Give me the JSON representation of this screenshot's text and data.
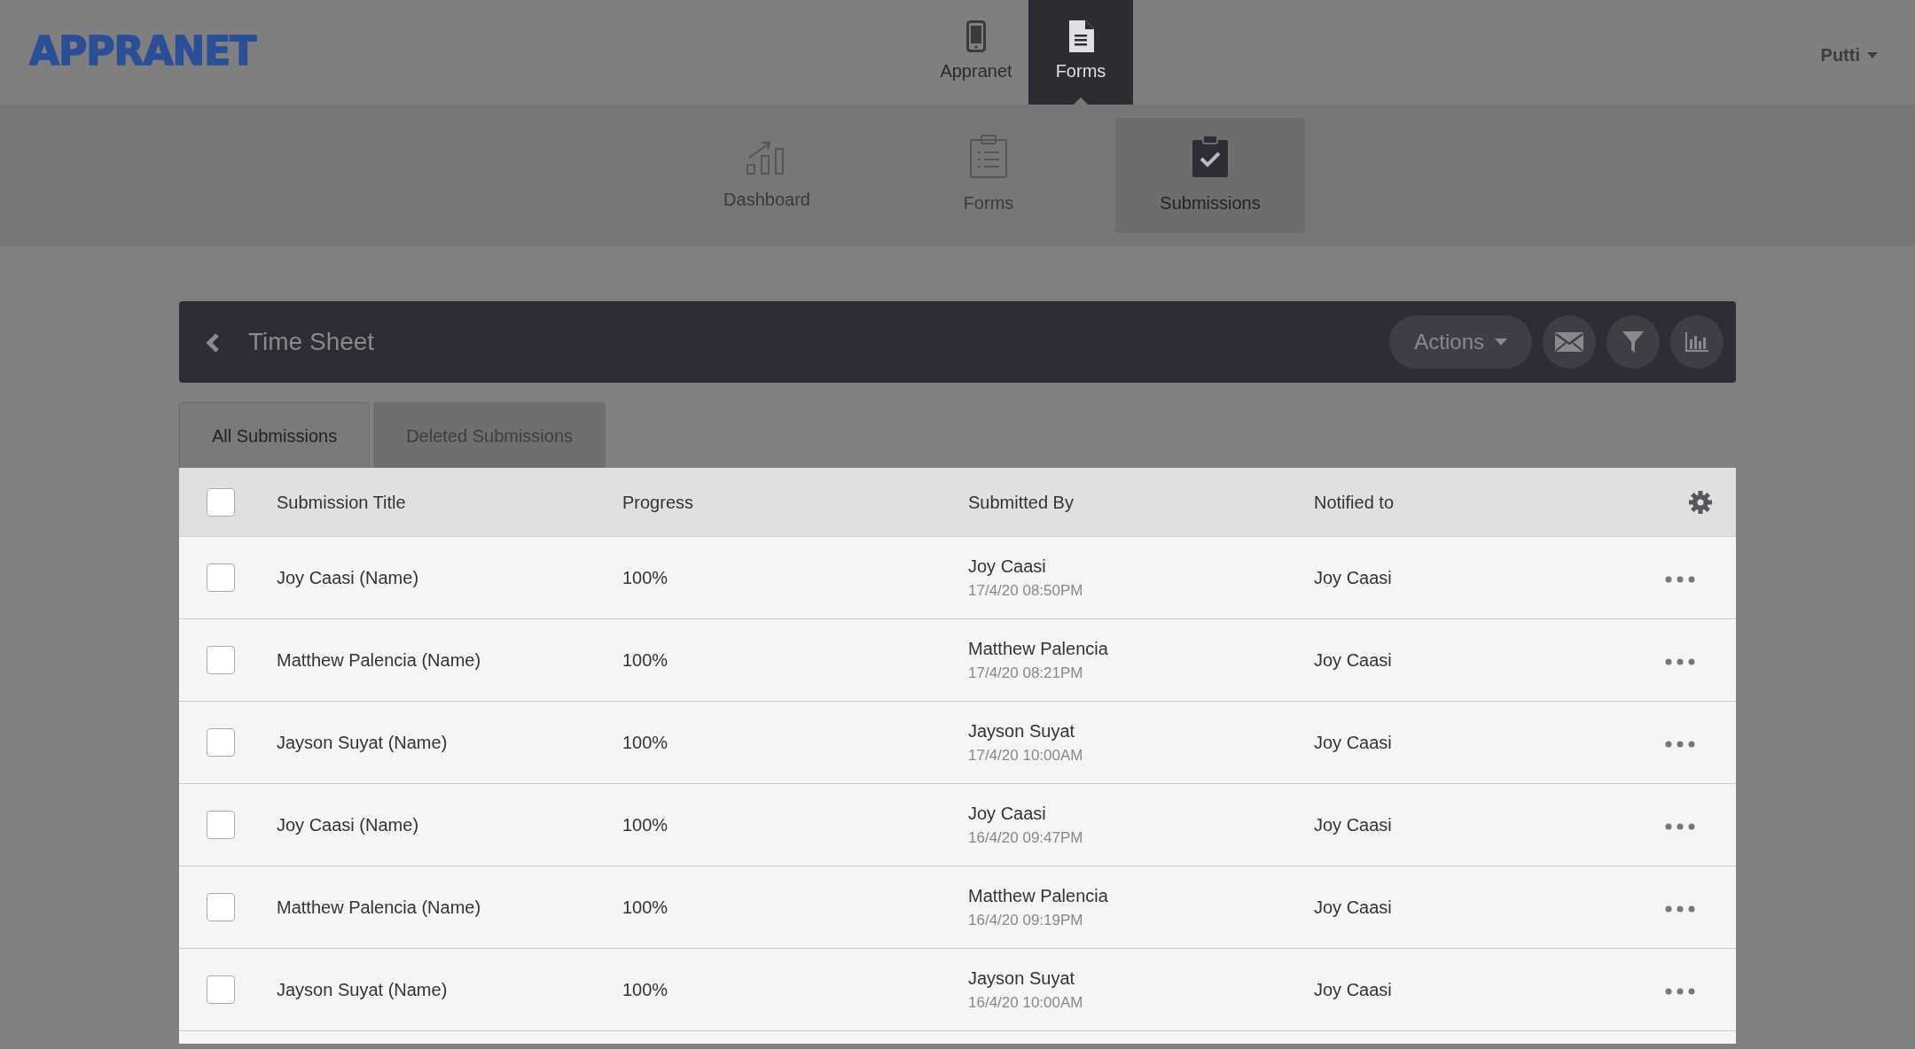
{
  "brand": "APPRANET",
  "top_nav": [
    {
      "label": "Appranet",
      "selected": false
    },
    {
      "label": "Forms",
      "selected": true
    }
  ],
  "user_menu": {
    "label": "Putti"
  },
  "sub_nav": [
    {
      "label": "Dashboard",
      "selected": false
    },
    {
      "label": "Forms",
      "selected": false
    },
    {
      "label": "Submissions",
      "selected": true
    }
  ],
  "title_bar": {
    "title": "Time Sheet",
    "actions_label": "Actions"
  },
  "tabs": [
    {
      "label": "All Submissions",
      "selected": true
    },
    {
      "label": "Deleted Submissions",
      "selected": false
    }
  ],
  "table": {
    "columns": [
      "Submission Title",
      "Progress",
      "Submitted By",
      "Notified to"
    ],
    "select_all_checked": false,
    "rows": [
      {
        "checked": false,
        "title": "Joy Caasi (Name)",
        "progress": "100%",
        "submitted_by": "Joy Caasi",
        "submitted_at": "17/4/20 08:50PM",
        "notified_to": "Joy Caasi"
      },
      {
        "checked": false,
        "title": "Matthew Palencia (Name)",
        "progress": "100%",
        "submitted_by": "Matthew Palencia",
        "submitted_at": "17/4/20 08:21PM",
        "notified_to": "Joy Caasi"
      },
      {
        "checked": false,
        "title": "Jayson Suyat (Name)",
        "progress": "100%",
        "submitted_by": "Jayson Suyat",
        "submitted_at": "17/4/20 10:00AM",
        "notified_to": "Joy Caasi"
      },
      {
        "checked": false,
        "title": "Joy Caasi (Name)",
        "progress": "100%",
        "submitted_by": "Joy Caasi",
        "submitted_at": "16/4/20 09:47PM",
        "notified_to": "Joy Caasi"
      },
      {
        "checked": false,
        "title": "Matthew Palencia (Name)",
        "progress": "100%",
        "submitted_by": "Matthew Palencia",
        "submitted_at": "16/4/20 09:19PM",
        "notified_to": "Joy Caasi"
      },
      {
        "checked": false,
        "title": "Jayson Suyat (Name)",
        "progress": "100%",
        "submitted_by": "Jayson Suyat",
        "submitted_at": "16/4/20 10:00AM",
        "notified_to": "Joy Caasi"
      }
    ]
  }
}
